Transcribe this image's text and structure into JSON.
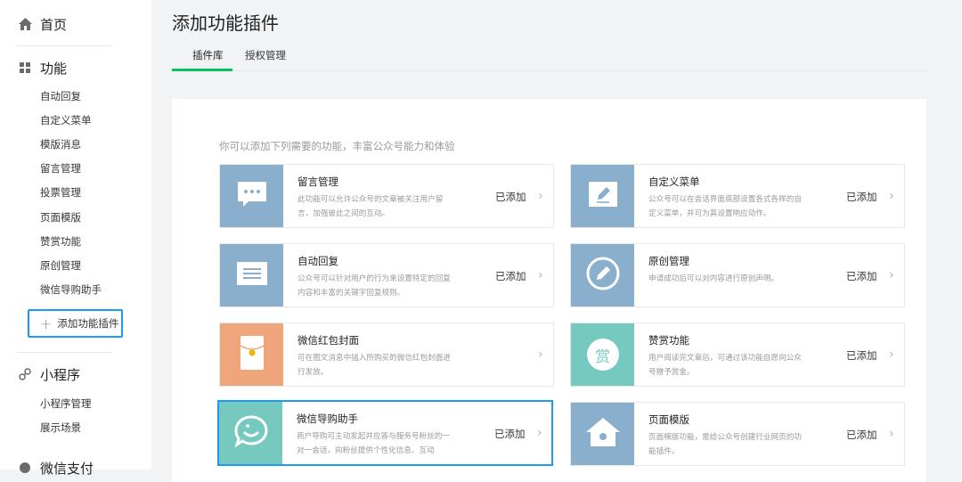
{
  "sidebar": {
    "home": {
      "label": "首页",
      "icon": "home-icon"
    },
    "features": {
      "label": "功能",
      "icon": "grid-icon",
      "items": [
        "自动回复",
        "自定义菜单",
        "模版消息",
        "留言管理",
        "投票管理",
        "页面模版",
        "赞赏功能",
        "原创管理",
        "微信导购助手"
      ],
      "add_label": "添加功能插件"
    },
    "mini": {
      "label": "小程序",
      "icon": "link-icon",
      "items": [
        "小程序管理",
        "展示场景"
      ]
    },
    "next": {
      "label": "微信支付"
    }
  },
  "header": {
    "title": "添加功能插件"
  },
  "tabs": [
    {
      "label": "插件库",
      "active": true
    },
    {
      "label": "授权管理",
      "active": false
    }
  ],
  "intro": "你可以添加下列需要的功能，丰富公众号能力和体验",
  "colors": {
    "accent_green": "#07c160",
    "selection_blue": "#1d9bf0",
    "tile_blue": "#8aafcd",
    "tile_orange": "#efa67a",
    "tile_teal": "#76c9be"
  },
  "plugins": [
    {
      "name": "留言管理",
      "desc": "此功能可以允许公众号的文章被关注用户留言，加强彼此之间的互动。",
      "status": "已添加",
      "icon": "speech-bubble-icon",
      "color": "#8aafcd"
    },
    {
      "name": "自定义菜单",
      "desc": "公众号可以在会话界面底部设置各式各样的自定义菜单，并可为其设置响应动作。",
      "status": "已添加",
      "icon": "pencil-icon",
      "color": "#8aafcd"
    },
    {
      "name": "自动回复",
      "desc": "公众号可以针对用户的行为来设置特定的回复内容和丰富的关键字回复规则。",
      "status": "已添加",
      "icon": "message-lines-icon",
      "color": "#8aafcd"
    },
    {
      "name": "原创管理",
      "desc": "申请成功后可以对内容进行原创声明。",
      "status": "已添加",
      "icon": "circle-pen-icon",
      "color": "#8aafcd"
    },
    {
      "name": "微信红包封面",
      "desc": "可在图文消息中插入所购买的微信红包封面进行发放。",
      "status": "",
      "icon": "red-envelope-icon",
      "color": "#efa67a"
    },
    {
      "name": "赞赏功能",
      "desc": "用户阅读完文章后，可通过该功能自愿向公众号赠予赏金。",
      "status": "已添加",
      "icon": "reward-icon",
      "color": "#76c9be",
      "icon_char": "赏"
    },
    {
      "name": "微信导购助手",
      "desc": "商户导购可主动发起并应答与服务号粉丝的一对一会话，向粉丝提供个性化信息、互动",
      "status": "已添加",
      "icon": "smile-chat-icon",
      "color": "#76c9be"
    },
    {
      "name": "页面模版",
      "desc": "页面模版功能，是给公众号创建行业网页的功能插件。",
      "status": "已添加",
      "icon": "house-icon",
      "color": "#8aafcd"
    }
  ]
}
